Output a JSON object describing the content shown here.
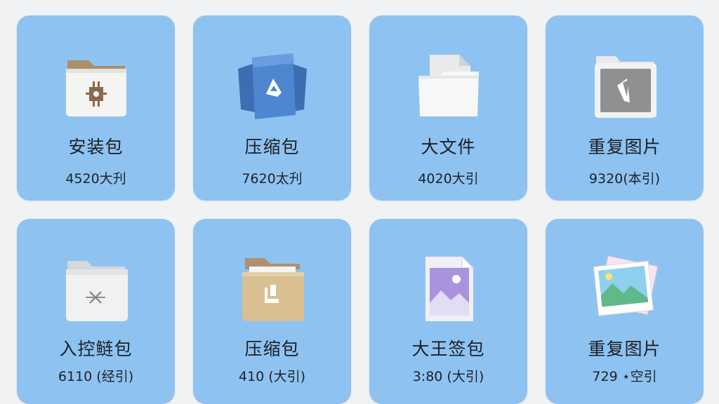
{
  "categories": [
    {
      "icon": "installer-folder-icon",
      "label": "安装包",
      "count": "4520大刋"
    },
    {
      "icon": "compressed-archive-icon",
      "label": "压缩包",
      "count": "7620太刋"
    },
    {
      "icon": "document-folder-icon",
      "label": "大文件",
      "count": "4020大引"
    },
    {
      "icon": "duplicate-image-folder-icon",
      "label": "重复图片",
      "count": "9320(本引)"
    },
    {
      "icon": "gray-folder-icon",
      "label": "入控鲢包",
      "count": "6110 (经引)"
    },
    {
      "icon": "tan-folder-icon",
      "label": "压缩包",
      "count": "410 (大引)"
    },
    {
      "icon": "image-file-icon",
      "label": "大王签包",
      "count": "3:80 (大引)"
    },
    {
      "icon": "photo-stack-icon",
      "label": "重复图片",
      "count": "729 ⋆空引"
    }
  ]
}
